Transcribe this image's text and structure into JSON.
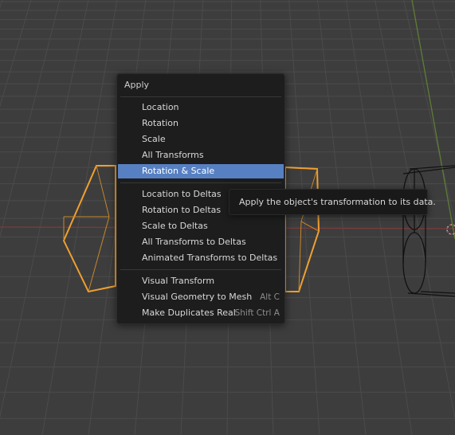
{
  "menu": {
    "title": "Apply",
    "items": [
      {
        "label": "Location"
      },
      {
        "label": "Rotation"
      },
      {
        "label": "Scale"
      },
      {
        "label": "All Transforms"
      },
      {
        "label": "Rotation & Scale",
        "highlighted": true
      },
      {
        "label": "Location to Deltas"
      },
      {
        "label": "Rotation to Deltas"
      },
      {
        "label": "Scale to Deltas"
      },
      {
        "label": "All Transforms to Deltas"
      },
      {
        "label": "Animated Transforms to Deltas"
      },
      {
        "label": "Visual Transform"
      },
      {
        "label": "Visual Geometry to Mesh",
        "shortcut": "Alt C"
      },
      {
        "label": "Make Duplicates Real",
        "shortcut": "Shift Ctrl A"
      }
    ]
  },
  "tooltip": {
    "text": "Apply the object's transformation to its data."
  },
  "colors": {
    "viewport_bg": "#3d3d3d",
    "grid": "#4a4a4a",
    "x_axis": "#8a3a3a",
    "y_axis": "#6b8a3a",
    "selected_outline": "#f0a030",
    "highlight": "#5680c2",
    "menu_bg": "#1d1d1d"
  }
}
